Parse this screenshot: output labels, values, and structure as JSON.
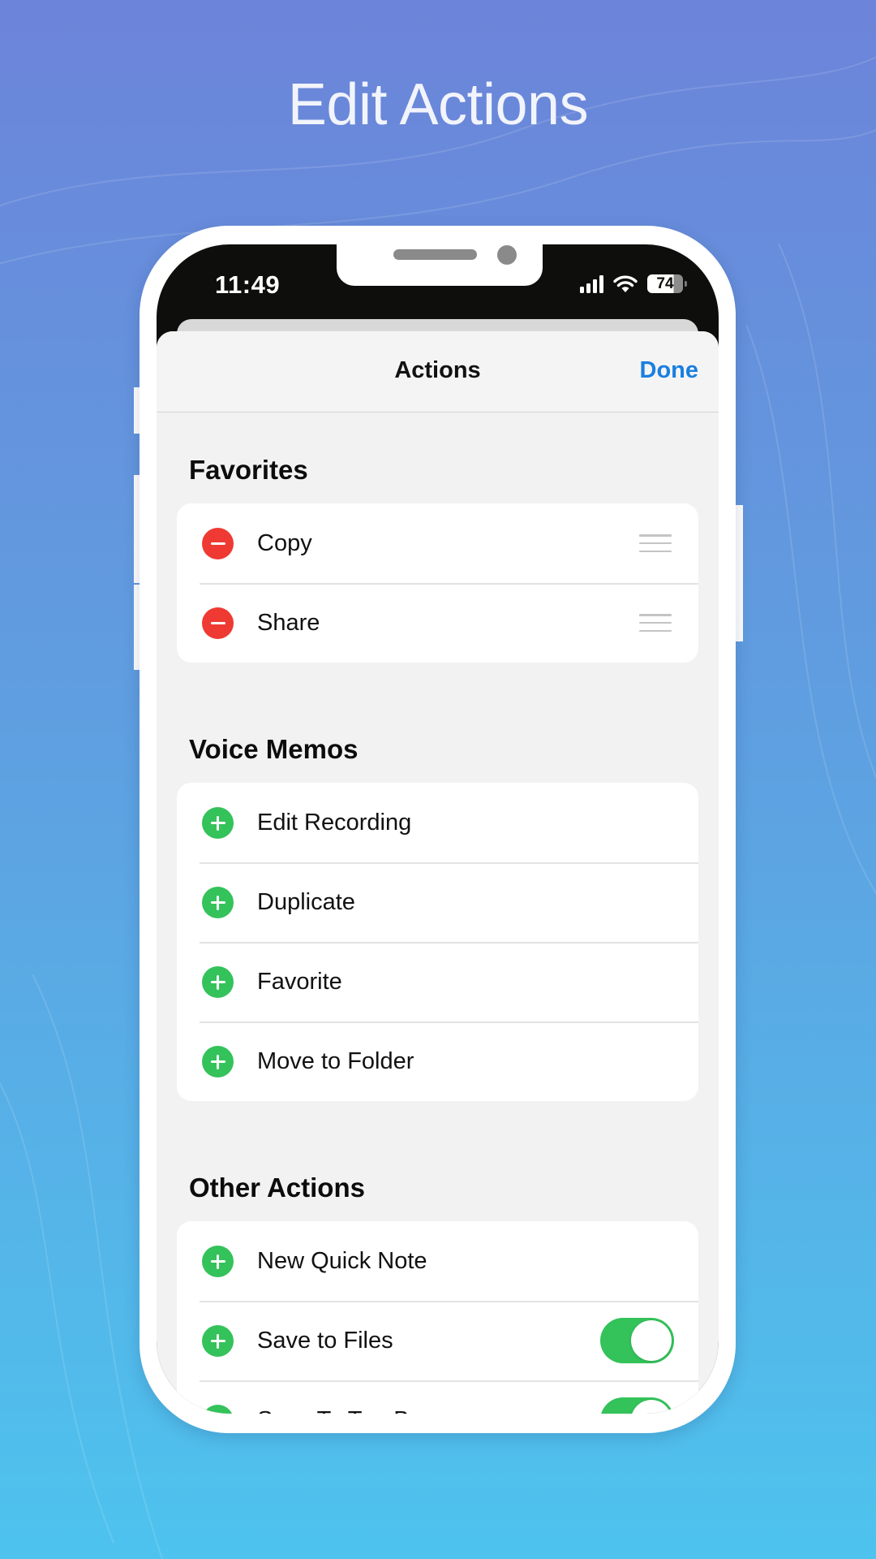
{
  "promo": {
    "title": "Edit Actions"
  },
  "status_bar": {
    "time": "11:49",
    "signal_icon": "cellular-signal-icon",
    "wifi_icon": "wifi-icon",
    "battery_percent": "74"
  },
  "sheet": {
    "title": "Actions",
    "done_label": "Done"
  },
  "colors": {
    "accent_blue": "#1a7fe0",
    "remove_red": "#ee3a33",
    "add_green": "#34c25a"
  },
  "sections": [
    {
      "title": "Favorites",
      "items": [
        {
          "label": "Copy",
          "control": "remove",
          "accessory": "drag-handle"
        },
        {
          "label": "Share",
          "control": "remove",
          "accessory": "drag-handle"
        }
      ]
    },
    {
      "title": "Voice Memos",
      "items": [
        {
          "label": "Edit Recording",
          "control": "add"
        },
        {
          "label": "Duplicate",
          "control": "add"
        },
        {
          "label": "Favorite",
          "control": "add"
        },
        {
          "label": "Move to Folder",
          "control": "add"
        }
      ]
    },
    {
      "title": "Other Actions",
      "items": [
        {
          "label": "New Quick Note",
          "control": "add"
        },
        {
          "label": "Save to Files",
          "control": "add",
          "toggle": true
        },
        {
          "label": "Save To TeraBox",
          "control": "add",
          "toggle": true
        }
      ]
    }
  ]
}
